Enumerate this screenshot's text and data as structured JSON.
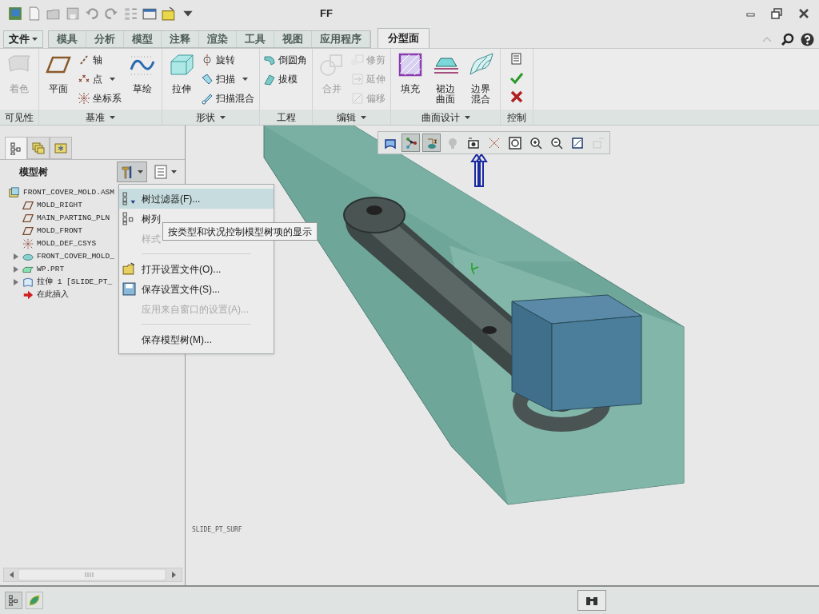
{
  "window": {
    "title": "FF"
  },
  "file_menu": {
    "label": "文件"
  },
  "tabs": [
    {
      "label": "模具",
      "selected": false
    },
    {
      "label": "分析",
      "selected": false
    },
    {
      "label": "模型",
      "selected": false
    },
    {
      "label": "注释",
      "selected": false
    },
    {
      "label": "渲染",
      "selected": false
    },
    {
      "label": "工具",
      "selected": false
    },
    {
      "label": "视图",
      "selected": false
    },
    {
      "label": "应用程序",
      "selected": false
    },
    {
      "label": "分型面",
      "selected": true
    }
  ],
  "ribbon": {
    "groups": [
      {
        "label": "可见性",
        "dropdown": false,
        "items": [
          {
            "kind": "large",
            "label": "着色",
            "disabled": true
          }
        ]
      },
      {
        "label": "基准",
        "dropdown": true,
        "items": [
          {
            "kind": "large",
            "label": "平面",
            "disabled": false
          },
          {
            "kind": "small",
            "label": "轴",
            "disabled": false,
            "dropdown": false
          },
          {
            "kind": "small",
            "label": "点",
            "disabled": false,
            "dropdown": true
          },
          {
            "kind": "small",
            "label": "坐标系",
            "disabled": false,
            "dropdown": false
          },
          {
            "kind": "large",
            "label": "草绘",
            "disabled": false
          }
        ]
      },
      {
        "label": "形状",
        "dropdown": true,
        "items": [
          {
            "kind": "large",
            "label": "拉伸",
            "disabled": false
          },
          {
            "kind": "small",
            "label": "旋转",
            "disabled": false,
            "dropdown": false
          },
          {
            "kind": "small",
            "label": "扫描",
            "disabled": false,
            "dropdown": true
          },
          {
            "kind": "small",
            "label": "扫描混合",
            "disabled": false,
            "dropdown": false
          }
        ]
      },
      {
        "label": "工程",
        "dropdown": false,
        "items": [
          {
            "kind": "small",
            "label": "倒圆角",
            "disabled": false,
            "dropdown": false
          },
          {
            "kind": "small",
            "label": "拔模",
            "disabled": false,
            "dropdown": false
          }
        ]
      },
      {
        "label": "编辑",
        "dropdown": true,
        "items": [
          {
            "kind": "large",
            "label": "合并",
            "disabled": true
          },
          {
            "kind": "small",
            "label": "修剪",
            "disabled": true,
            "dropdown": false
          },
          {
            "kind": "small",
            "label": "延伸",
            "disabled": true,
            "dropdown": false
          },
          {
            "kind": "small",
            "label": "偏移",
            "disabled": true,
            "dropdown": false
          }
        ]
      },
      {
        "label": "曲面设计",
        "dropdown": true,
        "items": [
          {
            "kind": "large",
            "label": "填充",
            "disabled": false
          },
          {
            "kind": "large",
            "label": "裙边曲面",
            "disabled": false
          },
          {
            "kind": "large",
            "label": "边界混合",
            "disabled": false
          }
        ]
      },
      {
        "label": "控制",
        "dropdown": false,
        "items": [
          {
            "kind": "icon",
            "disabled": false
          },
          {
            "kind": "icon",
            "disabled": false
          },
          {
            "kind": "icon",
            "disabled": false
          }
        ]
      }
    ]
  },
  "panel_tabs": [
    {
      "selected": true
    },
    {
      "selected": false
    },
    {
      "selected": false
    }
  ],
  "model_tree": {
    "title": "模型树",
    "settings_open": true,
    "items": [
      {
        "kind": "assembly",
        "label": "FRONT_COVER_MOLD.ASM",
        "children": [
          {
            "kind": "plane",
            "label": "MOLD_RIGHT"
          },
          {
            "kind": "plane",
            "label": "MAIN_PARTING_PLN"
          },
          {
            "kind": "plane",
            "label": "MOLD_FRONT"
          },
          {
            "kind": "csys",
            "label": "MOLD_DEF_CSYS"
          },
          {
            "kind": "part",
            "label": "FRONT_COVER_MOLD_",
            "expanded": false
          },
          {
            "kind": "workpiece",
            "label": "WP.PRT",
            "expanded": false
          },
          {
            "kind": "extrude",
            "label": "拉伸 1 [SLIDE_PT_",
            "expanded": false
          },
          {
            "kind": "insert",
            "label": "在此插入"
          }
        ]
      }
    ]
  },
  "tree_menu": [
    {
      "kind": "item",
      "label": "树过滤器(F)...",
      "disabled": false,
      "highlighted": true
    },
    {
      "kind": "item",
      "label": "树列",
      "disabled": false,
      "highlighted": false
    },
    {
      "kind": "item",
      "label": "样式",
      "disabled": true,
      "highlighted": false
    },
    {
      "kind": "separator"
    },
    {
      "kind": "item",
      "label": "打开设置文件(O)...",
      "disabled": false,
      "highlighted": false
    },
    {
      "kind": "item",
      "label": "保存设置文件(S)...",
      "disabled": false,
      "highlighted": false
    },
    {
      "kind": "item",
      "label": "应用来自窗口的设置(A)...",
      "disabled": true,
      "highlighted": false
    },
    {
      "kind": "separator"
    },
    {
      "kind": "item",
      "label": "保存模型树(M)...",
      "disabled": false,
      "highlighted": false
    }
  ],
  "tooltip": "按类型和状况控制模型树项的显示",
  "view_toolbar": [
    {
      "pressed": false,
      "disabled": false
    },
    {
      "pressed": true,
      "disabled": false
    },
    {
      "pressed": true,
      "disabled": false
    },
    {
      "pressed": false,
      "disabled": true
    },
    {
      "pressed": false,
      "disabled": false
    },
    {
      "pressed": false,
      "disabled": false
    },
    {
      "pressed": false,
      "disabled": false
    },
    {
      "pressed": false,
      "disabled": false
    },
    {
      "pressed": false,
      "disabled": false
    },
    {
      "pressed": false,
      "disabled": false
    },
    {
      "pressed": false,
      "disabled": true
    }
  ],
  "message": "SLIDE_PT_SURF"
}
